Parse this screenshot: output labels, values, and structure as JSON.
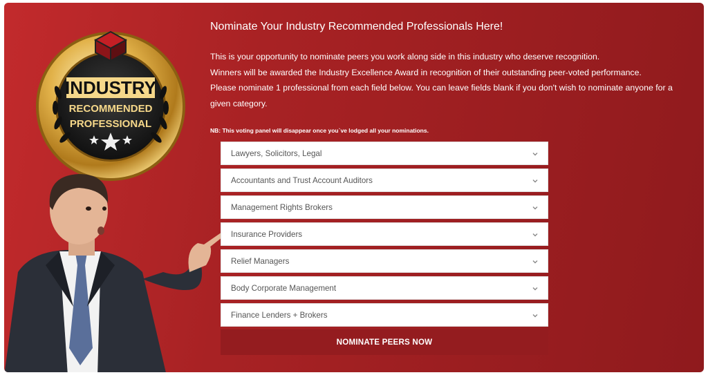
{
  "badge": {
    "line1": "INDUSTRY",
    "line2": "RECOMMENDED",
    "line3": "PROFESSIONAL",
    "icon": "logo-icon"
  },
  "form": {
    "title": "Nominate Your Industry Recommended Professionals Here!",
    "intro_line1": "This is your opportunity to nominate peers you work along side in this industry who deserve recognition.",
    "intro_line2": "Winners will be awarded the Industry Excellence Award in recognition of their outstanding peer-voted performance.",
    "intro_line3": "Please nominate 1 professional from each field below. You can leave fields blank if you don't wish to nominate anyone for a given category.",
    "note": "NB: This voting panel will disappear once you`ve lodged all your nominations.",
    "categories": [
      {
        "label": "Lawyers, Solicitors, Legal"
      },
      {
        "label": "Accountants and Trust Account Auditors"
      },
      {
        "label": "Management Rights Brokers"
      },
      {
        "label": "Insurance Providers"
      },
      {
        "label": "Relief Managers"
      },
      {
        "label": "Body Corporate Management"
      },
      {
        "label": "Finance Lenders + Brokers"
      }
    ],
    "submit_label": "NOMINATE PEERS NOW"
  },
  "colors": {
    "panel": "#a82224",
    "button": "#941c1f",
    "gold": "#d4a53a"
  }
}
